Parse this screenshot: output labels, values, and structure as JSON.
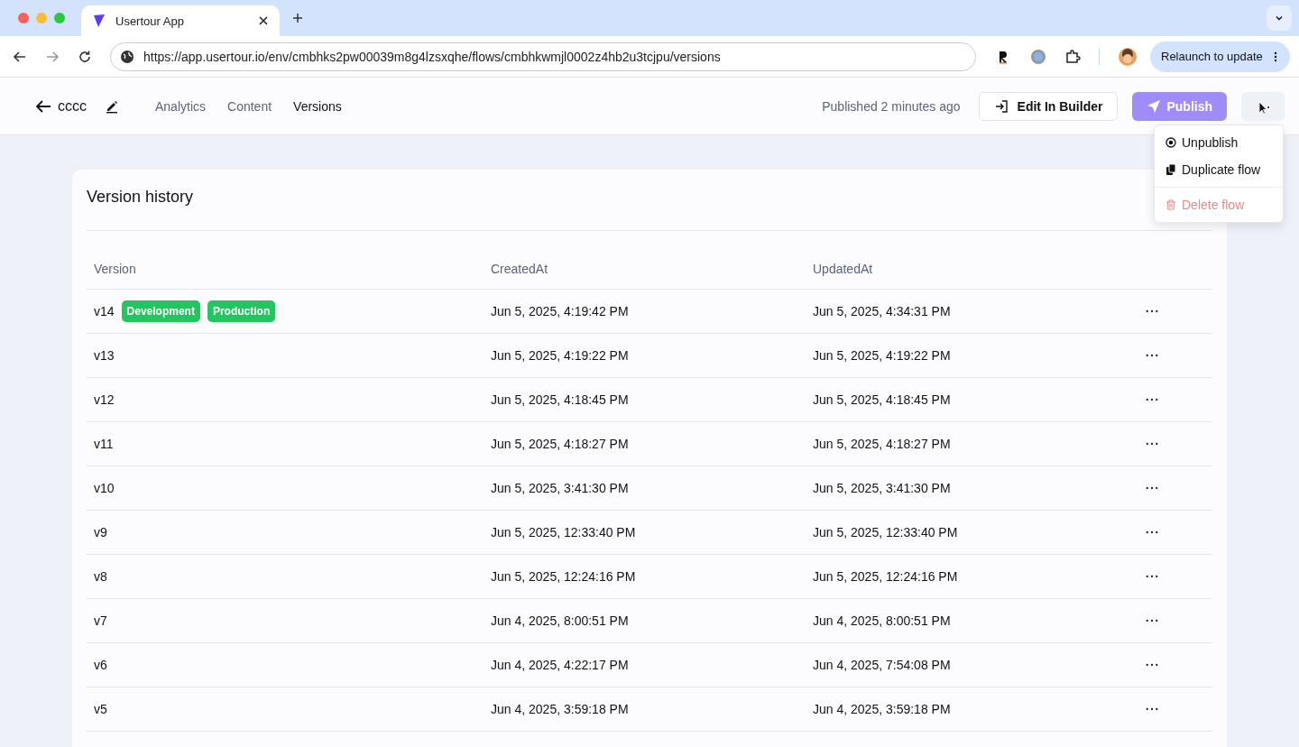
{
  "browser": {
    "tab_title": "Usertour App",
    "url": "https://app.usertour.io/env/cmbhks2pw00039m8g4lzsxqhe/flows/cmbhkwmjl0002z4hb2u3tcjpu/versions",
    "relaunch": "Relaunch to update"
  },
  "header": {
    "flow_name": "cccc",
    "tabs": [
      {
        "label": "Analytics",
        "selected": false
      },
      {
        "label": "Content",
        "selected": false
      },
      {
        "label": "Versions",
        "selected": true
      }
    ],
    "status": "Published 2 minutes ago",
    "edit_button": "Edit In Builder",
    "publish_button": "Publish"
  },
  "menu": [
    {
      "label": "Unpublish",
      "kind": "unpublish"
    },
    {
      "label": "Duplicate flow",
      "kind": "duplicate"
    },
    {
      "label": "Delete flow",
      "kind": "delete"
    }
  ],
  "card": {
    "title": "Version history",
    "columns": [
      "Version",
      "CreatedAt",
      "UpdatedAt"
    ],
    "rows": [
      {
        "version": "v14",
        "badges": [
          "Development",
          "Production"
        ],
        "created": "Jun 5, 2025, 4:19:42 PM",
        "updated": "Jun 5, 2025, 4:34:31 PM"
      },
      {
        "version": "v13",
        "created": "Jun 5, 2025, 4:19:22 PM",
        "updated": "Jun 5, 2025, 4:19:22 PM"
      },
      {
        "version": "v12",
        "created": "Jun 5, 2025, 4:18:45 PM",
        "updated": "Jun 5, 2025, 4:18:45 PM"
      },
      {
        "version": "v11",
        "created": "Jun 5, 2025, 4:18:27 PM",
        "updated": "Jun 5, 2025, 4:18:27 PM"
      },
      {
        "version": "v10",
        "created": "Jun 5, 2025, 3:41:30 PM",
        "updated": "Jun 5, 2025, 3:41:30 PM"
      },
      {
        "version": "v9",
        "created": "Jun 5, 2025, 12:33:40 PM",
        "updated": "Jun 5, 2025, 12:33:40 PM"
      },
      {
        "version": "v8",
        "created": "Jun 5, 2025, 12:24:16 PM",
        "updated": "Jun 5, 2025, 12:24:16 PM"
      },
      {
        "version": "v7",
        "created": "Jun 4, 2025, 8:00:51 PM",
        "updated": "Jun 4, 2025, 8:00:51 PM"
      },
      {
        "version": "v6",
        "created": "Jun 4, 2025, 4:22:17 PM",
        "updated": "Jun 4, 2025, 7:54:08 PM"
      },
      {
        "version": "v5",
        "created": "Jun 4, 2025, 3:59:18 PM",
        "updated": "Jun 4, 2025, 3:59:18 PM"
      }
    ]
  }
}
